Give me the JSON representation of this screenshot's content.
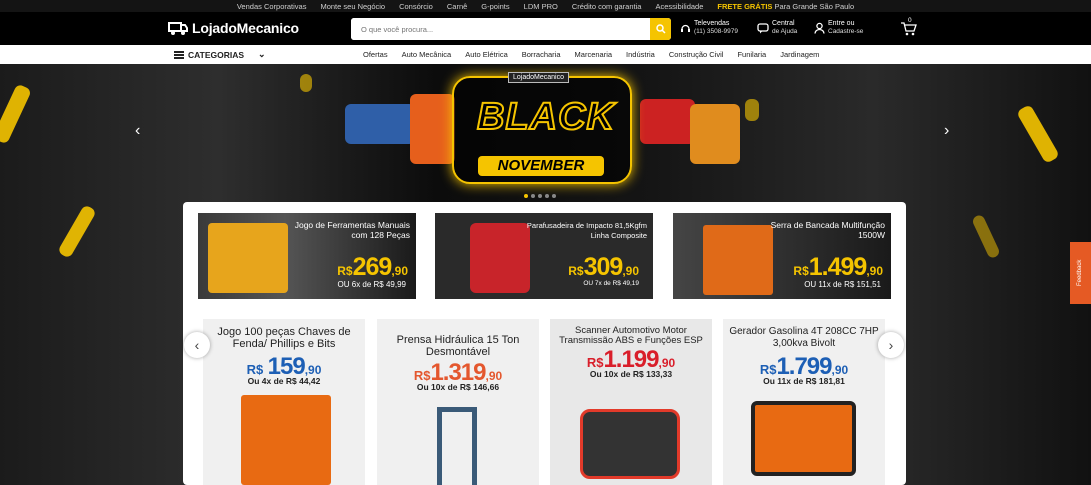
{
  "topbar": {
    "links": [
      "Vendas Corporativas",
      "Monte seu Negócio",
      "Consórcio",
      "Carnê",
      "G-points",
      "LDM PRO",
      "Crédito com garantia",
      "Acessibilidade"
    ],
    "promo_bold": "FRETE GRÁTIS",
    "promo_rest": " Para Grande São Paulo"
  },
  "header": {
    "logo": "LojadoMecanico",
    "search_placeholder": "O que você procura...",
    "televendas_label": "Televendas",
    "televendas_phone": "(11) 3508-9979",
    "central_label": "Central",
    "central_sub": "de Ajuda",
    "entre_label": "Entre ou",
    "entre_sub": "Cadastre-se",
    "cart_count": "0"
  },
  "nav": {
    "categorias": "CATEGORIAS",
    "links": [
      "Ofertas",
      "Auto Mecânica",
      "Auto Elétrica",
      "Borracharia",
      "Marcenaria",
      "Indústria",
      "Construção Civil",
      "Funilaria",
      "Jardinagem"
    ]
  },
  "hero": {
    "logo_text": "LojadoMecanico",
    "title1": "BLACK",
    "title2": "NOVEMBER"
  },
  "banners": [
    {
      "title": "Jogo de Ferramentas Manuais com 128 Peças",
      "rs": "R$",
      "price": "269",
      "cents": ",90",
      "offer": "OU 6x de R$ 49,99"
    },
    {
      "title": "Parafusadeira de Impacto 81,5Kgfm Linha Composite",
      "rs": "R$",
      "price": "309",
      "cents": ",90",
      "offer": "OU 7x de R$ 49,19"
    },
    {
      "title": "Serra de Bancada Multifunção 1500W",
      "rs": "R$",
      "price": "1.499",
      "cents": ",90",
      "offer": "OU 11x de R$ 151,51"
    }
  ],
  "cards": [
    {
      "title": "Jogo 100 peças Chaves de Fenda/ Phillips e Bits",
      "rs": "R$",
      "price": "159",
      "cents": ",90",
      "offer": "Ou 4x de R$ 44,42",
      "color": "#1d5fb5"
    },
    {
      "title": "Prensa Hidráulica 15 Ton Desmontável",
      "rs": "R$",
      "price": "1.319",
      "cents": ",90",
      "offer": "Ou 10x de R$ 146,66",
      "color": "#e4572e"
    },
    {
      "title": "Scanner Automotivo Motor Transmissão ABS e Funções ESP",
      "rs": "R$",
      "price": "1.199",
      "cents": ",90",
      "offer": "Ou 10x de R$ 133,33",
      "color": "#d91e2a"
    },
    {
      "title": "Gerador Gasolina 4T 208CC 7HP 3,00kva Bivolt",
      "rs": "R$",
      "price": "1.799",
      "cents": ",90",
      "offer": "Ou 11x de R$ 181,81",
      "color": "#1d5fb5"
    }
  ],
  "feedback": "Feedback"
}
